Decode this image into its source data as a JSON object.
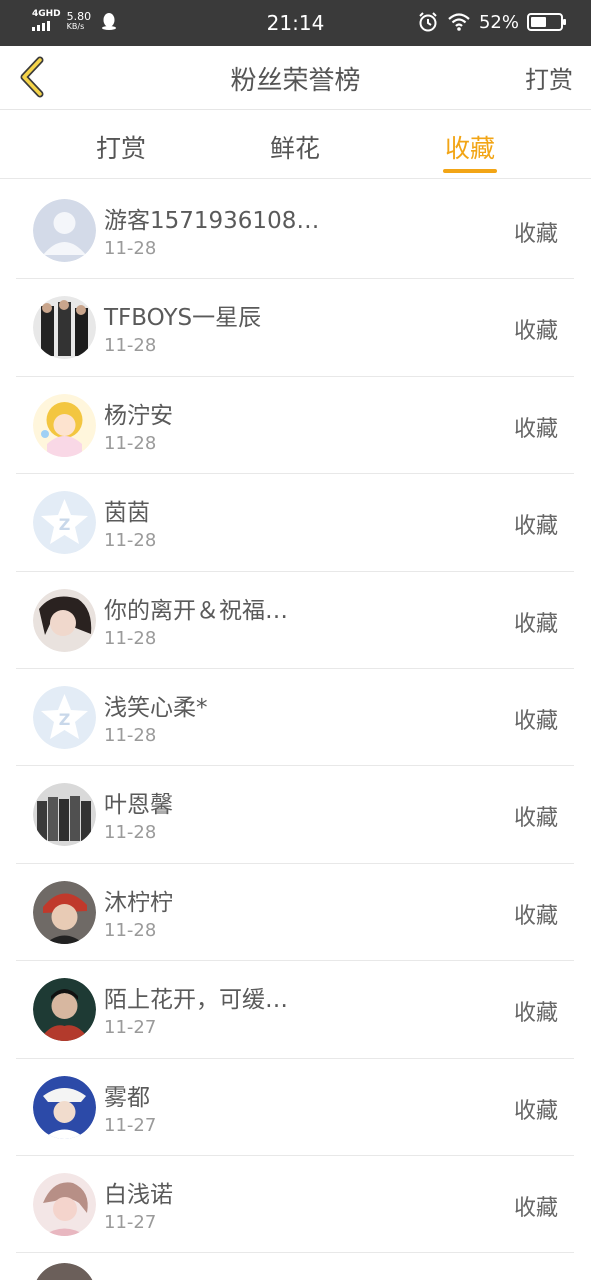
{
  "status_bar": {
    "network": "4GHD",
    "speed_value": "5.80",
    "speed_unit": "KB/s",
    "time": "21:14",
    "battery_percent": "52%",
    "battery_level": 0.52
  },
  "header": {
    "title": "粉丝荣誉榜",
    "action": "打赏"
  },
  "tabs": [
    {
      "label": "打赏",
      "active": false
    },
    {
      "label": "鲜花",
      "active": false
    },
    {
      "label": "收藏",
      "active": true
    }
  ],
  "accent_color": "#f2a516",
  "rows": [
    {
      "name": "游客1571936108…",
      "date": "11-28",
      "action": "收藏",
      "avatar": "default-person-avatar"
    },
    {
      "name": "TFBOYS一星辰",
      "date": "11-28",
      "action": "收藏",
      "avatar": "photo-avatar"
    },
    {
      "name": "杨泞安",
      "date": "11-28",
      "action": "收藏",
      "avatar": "anime-avatar"
    },
    {
      "name": "茵茵",
      "date": "11-28",
      "action": "收藏",
      "avatar": "default-star-avatar"
    },
    {
      "name": "你的离开＆祝福…",
      "date": "11-28",
      "action": "收藏",
      "avatar": "photo-avatar"
    },
    {
      "name": "浅笑心柔*",
      "date": "11-28",
      "action": "收藏",
      "avatar": "default-star-avatar"
    },
    {
      "name": "叶恩馨",
      "date": "11-28",
      "action": "收藏",
      "avatar": "photo-avatar"
    },
    {
      "name": "沐柠柠",
      "date": "11-28",
      "action": "收藏",
      "avatar": "photo-avatar"
    },
    {
      "name": "陌上花开，可缓…",
      "date": "11-27",
      "action": "收藏",
      "avatar": "photo-avatar"
    },
    {
      "name": "雾都",
      "date": "11-27",
      "action": "收藏",
      "avatar": "photo-avatar"
    },
    {
      "name": "白浅诺",
      "date": "11-27",
      "action": "收藏",
      "avatar": "photo-avatar"
    }
  ]
}
